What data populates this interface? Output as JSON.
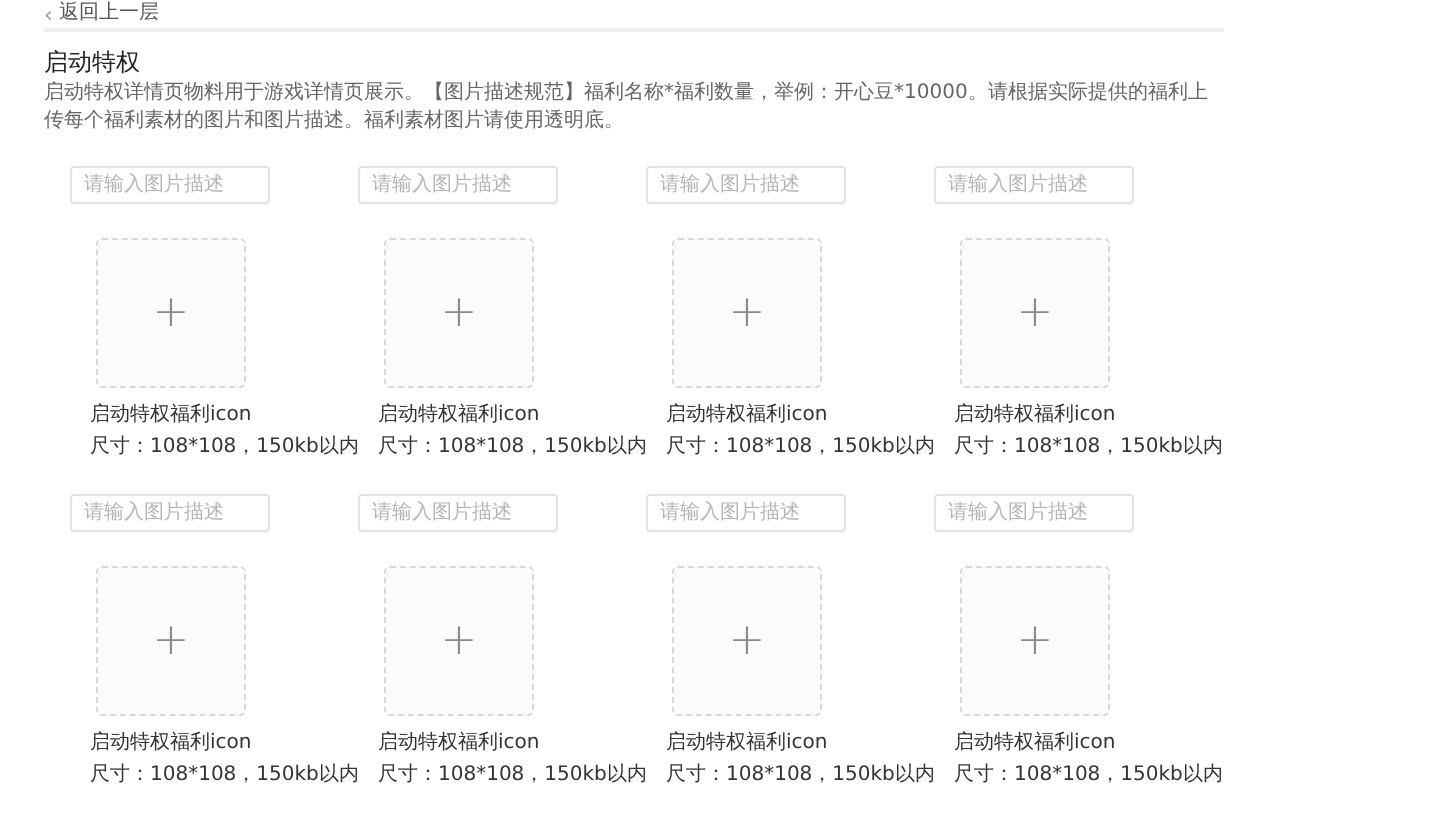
{
  "back_link": {
    "arrow": "‹",
    "label": "返回上一层"
  },
  "section": {
    "title": "启动特权",
    "description": "启动特权详情页物料用于游戏详情页展示。【图片描述规范】福利名称*福利数量，举例：开心豆*10000。请根据实际提供的福利上传每个福利素材的图片和图片描述。福利素材图片请使用透明底。"
  },
  "items": [
    {
      "placeholder": "请输入图片描述",
      "upload": "+",
      "label": "启动特权福利icon",
      "size": "尺寸：108*108，150kb以内"
    },
    {
      "placeholder": "请输入图片描述",
      "upload": "+",
      "label": "启动特权福利icon",
      "size": "尺寸：108*108，150kb以内"
    },
    {
      "placeholder": "请输入图片描述",
      "upload": "+",
      "label": "启动特权福利icon",
      "size": "尺寸：108*108，150kb以内"
    },
    {
      "placeholder": "请输入图片描述",
      "upload": "+",
      "label": "启动特权福利icon",
      "size": "尺寸：108*108，150kb以内"
    },
    {
      "placeholder": "请输入图片描述",
      "upload": "+",
      "label": "启动特权福利icon",
      "size": "尺寸：108*108，150kb以内"
    },
    {
      "placeholder": "请输入图片描述",
      "upload": "+",
      "label": "启动特权福利icon",
      "size": "尺寸：108*108，150kb以内"
    },
    {
      "placeholder": "请输入图片描述",
      "upload": "+",
      "label": "启动特权福利icon",
      "size": "尺寸：108*108，150kb以内"
    },
    {
      "placeholder": "请输入图片描述",
      "upload": "+",
      "label": "启动特权福利icon",
      "size": "尺寸：108*108，150kb以内"
    }
  ]
}
